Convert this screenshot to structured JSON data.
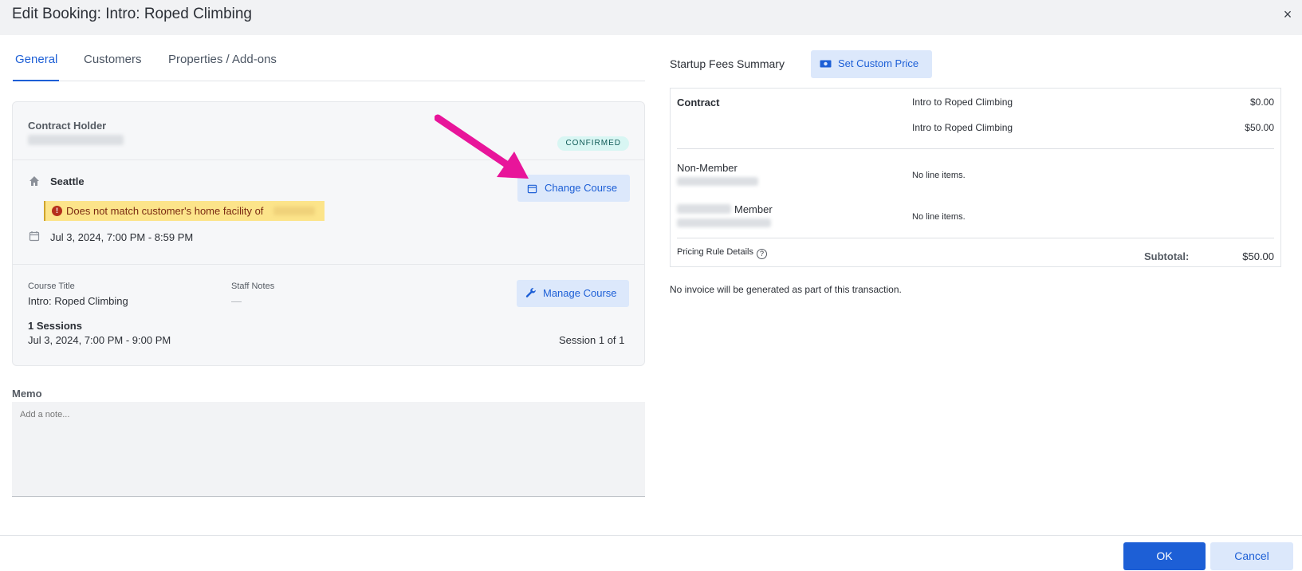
{
  "window": {
    "title": "Edit Booking: Intro: Roped Climbing",
    "close_icon": "×"
  },
  "tabs": [
    {
      "label": "General",
      "active": true
    },
    {
      "label": "Customers",
      "active": false
    },
    {
      "label": "Properties / Add-ons",
      "active": false
    }
  ],
  "booking": {
    "contract_holder_label": "Contract Holder",
    "status_badge": "CONFIRMED",
    "facility": "Seattle",
    "warning": "Does not match customer's home facility of",
    "datetime": "Jul 3, 2024, 7:00 PM - 8:59 PM",
    "change_course_label": "Change Course",
    "course_title_label": "Course Title",
    "course_title": "Intro: Roped Climbing",
    "staff_notes_label": "Staff Notes",
    "staff_notes": "—",
    "manage_course_label": "Manage Course",
    "sessions_label": "1 Sessions",
    "sessions_datetime": "Jul 3, 2024, 7:00 PM - 9:00 PM",
    "session_position": "Session 1 of 1"
  },
  "memo": {
    "label": "Memo",
    "placeholder": "Add a note..."
  },
  "summary": {
    "title": "Startup Fees Summary",
    "custom_price_label": "Set Custom Price",
    "contract_label": "Contract",
    "contract_items": [
      {
        "name": "Intro to Roped Climbing",
        "amount": "$0.00"
      },
      {
        "name": "Intro to Roped Climbing",
        "amount": "$50.00"
      }
    ],
    "non_member_label": "Non-Member",
    "non_member_items": "No line items.",
    "member_label": "Member",
    "member_items": "No line items.",
    "pricing_rule_label": "Pricing Rule Details",
    "subtotal_label": "Subtotal:",
    "subtotal_amount": "$50.00"
  },
  "invoice_note": "No invoice will be generated as part of this transaction.",
  "footer": {
    "ok_label": "OK",
    "cancel_label": "Cancel"
  },
  "colors": {
    "accent": "#1d5fd6",
    "annotation_arrow": "#e8159a"
  }
}
